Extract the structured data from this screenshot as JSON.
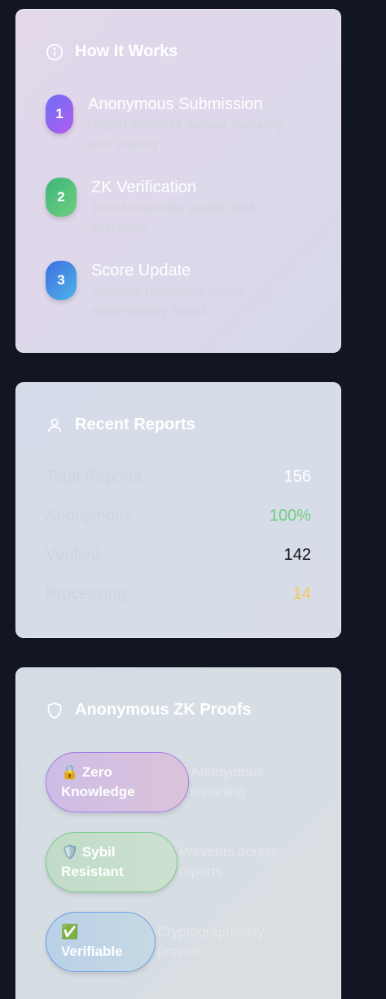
{
  "how_it_works": {
    "title": "How It Works",
    "steps": [
      {
        "num": "1",
        "title": "Anonymous Submission",
        "desc": "Report incidents without revealing your identity",
        "color": "#8b5cf6"
      },
      {
        "num": "2",
        "title": "ZK Verification",
        "desc": "Zero-knowledge proofs verify legitimacy",
        "color": "#4fbf72"
      },
      {
        "num": "3",
        "title": "Score Update",
        "desc": "Validator reputation scores automatically adjust",
        "color": "#4a86e8"
      }
    ]
  },
  "recent_reports": {
    "title": "Recent Reports",
    "stats": [
      {
        "label": "Total Reports",
        "value": "156",
        "color": "#ffffff"
      },
      {
        "label": "Anonymous",
        "value": "100%",
        "color": "#6fcf7f"
      },
      {
        "label": "Verified",
        "value": "142",
        "color": "#111111"
      },
      {
        "label": "Processing",
        "value": "14",
        "color": "#f2c94c"
      }
    ]
  },
  "zk_proofs": {
    "title": "Anonymous ZK Proofs",
    "proofs": [
      {
        "emoji": "🔒",
        "label_line1": "Zero",
        "label_line2": "Knowledge",
        "desc": "Anonymous reporting"
      },
      {
        "emoji": "🛡️",
        "label_line1": "Sybil",
        "label_line2": "Resistant",
        "desc": "Prevents double reports"
      },
      {
        "emoji": "✅",
        "label_line1": "",
        "label_line2": "Verifiable",
        "desc": "Cryptographically proven"
      }
    ]
  }
}
